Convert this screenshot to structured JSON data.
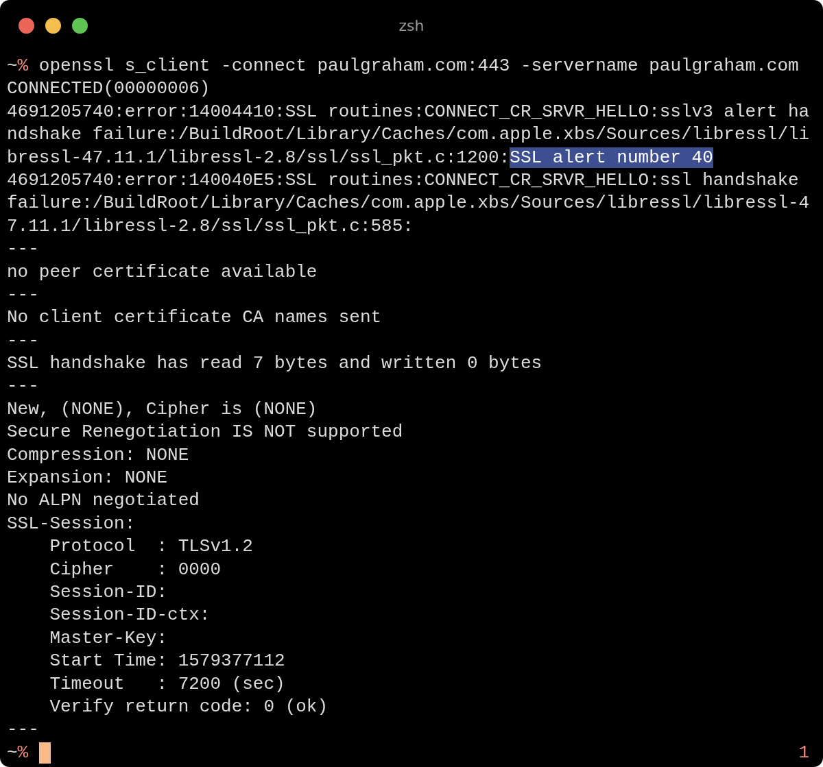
{
  "window": {
    "title": "zsh"
  },
  "lines": [
    {
      "kind": "prompt",
      "dir": "~",
      "symbol": "%",
      "text": "openssl s_client -connect paulgraham.com:443 -servername paulgraham.com"
    },
    {
      "kind": "output",
      "text": "CONNECTED(00000006)"
    },
    {
      "kind": "output",
      "text": "4691205740:error:14004410:SSL routines:CONNECT_CR_SRVR_HELLO:sslv3 alert ha"
    },
    {
      "kind": "output",
      "text": "ndshake failure:/BuildRoot/Library/Caches/com.apple.xbs/Sources/libressl/li"
    },
    {
      "kind": "output",
      "text": "bressl-47.11.1/libressl-2.8/ssl/ssl_pkt.c:1200:",
      "selected_text": "SSL alert number 40"
    },
    {
      "kind": "output",
      "text": "4691205740:error:140040E5:SSL routines:CONNECT_CR_SRVR_HELLO:ssl handshake"
    },
    {
      "kind": "output",
      "text": "failure:/BuildRoot/Library/Caches/com.apple.xbs/Sources/libressl/libressl-4"
    },
    {
      "kind": "output",
      "text": "7.11.1/libressl-2.8/ssl/ssl_pkt.c:585:"
    },
    {
      "kind": "output",
      "text": "---"
    },
    {
      "kind": "output",
      "text": "no peer certificate available"
    },
    {
      "kind": "output",
      "text": "---"
    },
    {
      "kind": "output",
      "text": "No client certificate CA names sent"
    },
    {
      "kind": "output",
      "text": "---"
    },
    {
      "kind": "output",
      "text": "SSL handshake has read 7 bytes and written 0 bytes"
    },
    {
      "kind": "output",
      "text": "---"
    },
    {
      "kind": "output",
      "text": "New, (NONE), Cipher is (NONE)"
    },
    {
      "kind": "output",
      "text": "Secure Renegotiation IS NOT supported"
    },
    {
      "kind": "output",
      "text": "Compression: NONE"
    },
    {
      "kind": "output",
      "text": "Expansion: NONE"
    },
    {
      "kind": "output",
      "text": "No ALPN negotiated"
    },
    {
      "kind": "output",
      "text": "SSL-Session:"
    },
    {
      "kind": "output",
      "text": "    Protocol  : TLSv1.2"
    },
    {
      "kind": "output",
      "text": "    Cipher    : 0000"
    },
    {
      "kind": "output",
      "text": "    Session-ID:"
    },
    {
      "kind": "output",
      "text": "    Session-ID-ctx:"
    },
    {
      "kind": "output",
      "text": "    Master-Key:"
    },
    {
      "kind": "output",
      "text": "    Start Time: 1579377112"
    },
    {
      "kind": "output",
      "text": "    Timeout   : 7200 (sec)"
    },
    {
      "kind": "output",
      "text": "    Verify return code: 0 (ok)"
    },
    {
      "kind": "output",
      "text": "---"
    },
    {
      "kind": "input",
      "dir": "~",
      "symbol": "%",
      "right_text": "1"
    }
  ]
}
